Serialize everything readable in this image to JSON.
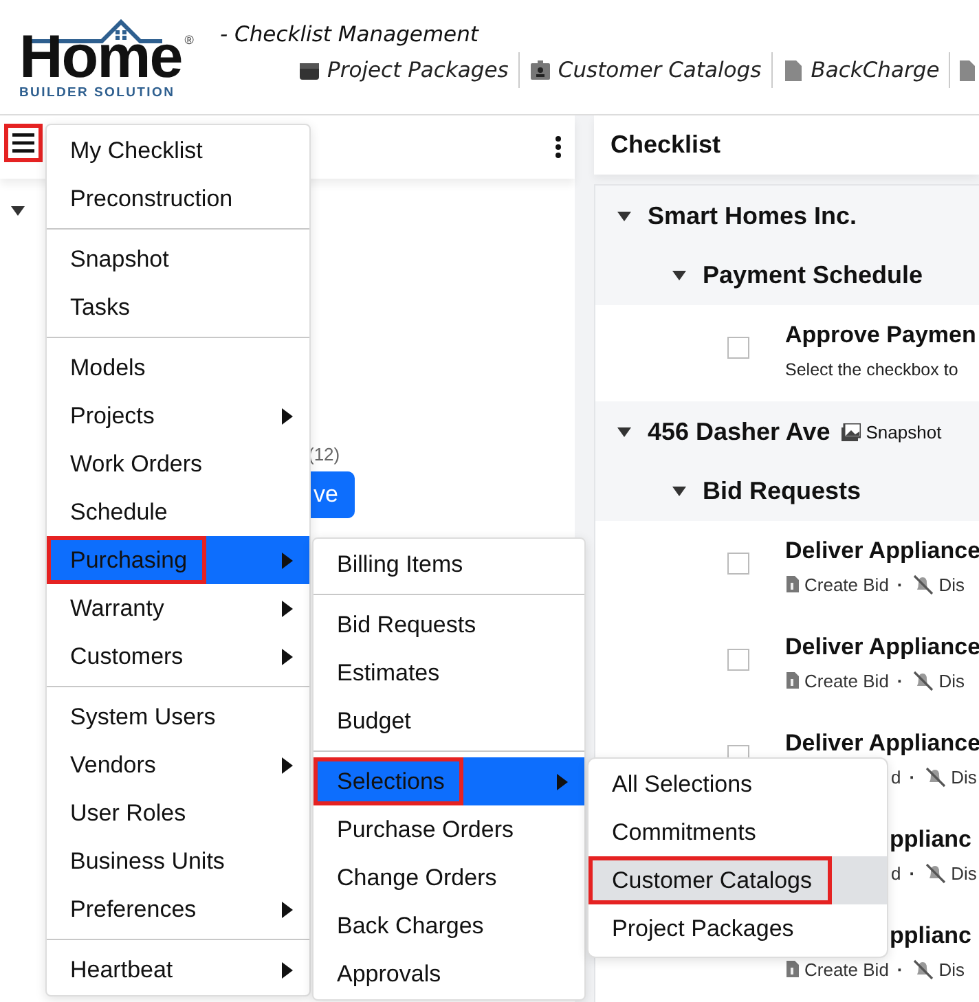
{
  "header": {
    "logo": {
      "word": "Home",
      "mark": "®",
      "tagline": "BUILDER SOLUTION"
    },
    "title": "- Checklist Management",
    "nav": [
      {
        "kind": "package",
        "label": "Project Packages"
      },
      {
        "kind": "badge",
        "label": "Customer Catalogs"
      },
      {
        "kind": "file",
        "label": "BackCharge"
      }
    ]
  },
  "left_panel": {
    "count": "(12)",
    "button": "ve"
  },
  "checklist": {
    "title": "Checklist",
    "groups": [
      {
        "title": "Smart Homes Inc.",
        "sections": [
          {
            "title": "Payment Schedule",
            "items": [
              {
                "kind": "note",
                "title": "Approve Paymen",
                "note": "Select the checkbox to",
                "checked": false
              }
            ]
          }
        ]
      },
      {
        "title": "456 Dasher Ave",
        "tag": "Snapshot",
        "sections": [
          {
            "title": "Bid Requests",
            "items": [
              {
                "kind": "open",
                "title": "Deliver Appliance",
                "action": "Create Bid",
                "separator": "·",
                "dismiss": "Dis",
                "checked": false
              },
              {
                "kind": "open",
                "title": "Deliver Appliance",
                "action": "Create Bid",
                "separator": "·",
                "dismiss": "Dis",
                "checked": false
              },
              {
                "kind": "action-covered",
                "title": "Deliver Appliance",
                "action": "d",
                "separator": "·",
                "dismiss": "Dis",
                "checked": false
              },
              {
                "kind": "covered",
                "title": "pplianc",
                "action": "d",
                "separator": "·",
                "dismiss": "Dis"
              },
              {
                "kind": "title-covered",
                "title": "pplianc",
                "action": "Create Bid",
                "separator": "·",
                "dismiss": "Dis"
              }
            ]
          }
        ]
      }
    ]
  },
  "menu_button": {
    "highlighted": true
  },
  "menus": [
    {
      "sections": [
        [
          {
            "label": "My Checklist",
            "submenu": false,
            "selected": false,
            "highlighted": false
          },
          {
            "label": "Preconstruction",
            "submenu": false,
            "selected": false,
            "highlighted": false
          }
        ],
        [
          {
            "label": "Snapshot",
            "submenu": false,
            "selected": false,
            "highlighted": false
          },
          {
            "label": "Tasks",
            "submenu": false,
            "selected": false,
            "highlighted": false
          }
        ],
        [
          {
            "label": "Models",
            "submenu": false,
            "selected": false,
            "highlighted": false
          },
          {
            "label": "Projects",
            "submenu": true,
            "selected": false,
            "highlighted": false
          },
          {
            "label": "Work Orders",
            "submenu": false,
            "selected": false,
            "highlighted": false
          },
          {
            "label": "Schedule",
            "submenu": false,
            "selected": false,
            "highlighted": false
          },
          {
            "label": "Purchasing",
            "submenu": true,
            "selected": true,
            "highlighted": true
          },
          {
            "label": "Warranty",
            "submenu": true,
            "selected": false,
            "highlighted": false
          },
          {
            "label": "Customers",
            "submenu": true,
            "selected": false,
            "highlighted": false
          }
        ],
        [
          {
            "label": "System Users",
            "submenu": false,
            "selected": false,
            "highlighted": false
          },
          {
            "label": "Vendors",
            "submenu": true,
            "selected": false,
            "highlighted": false
          },
          {
            "label": "User Roles",
            "submenu": false,
            "selected": false,
            "highlighted": false
          },
          {
            "label": "Business Units",
            "submenu": false,
            "selected": false,
            "highlighted": false
          },
          {
            "label": "Preferences",
            "submenu": true,
            "selected": false,
            "highlighted": false
          }
        ],
        [
          {
            "label": "Heartbeat",
            "submenu": true,
            "selected": false,
            "highlighted": false
          }
        ]
      ]
    },
    {
      "sections": [
        [
          {
            "label": "Billing Items",
            "submenu": false,
            "selected": false,
            "highlighted": false
          }
        ],
        [
          {
            "label": "Bid Requests",
            "submenu": false,
            "selected": false,
            "highlighted": false
          },
          {
            "label": "Estimates",
            "submenu": false,
            "selected": false,
            "highlighted": false
          },
          {
            "label": "Budget",
            "submenu": false,
            "selected": false,
            "highlighted": false
          }
        ],
        [
          {
            "label": "Selections",
            "submenu": true,
            "selected": true,
            "highlighted": true
          },
          {
            "label": "Purchase Orders",
            "submenu": false,
            "selected": false,
            "highlighted": false
          },
          {
            "label": "Change Orders",
            "submenu": false,
            "selected": false,
            "highlighted": false
          },
          {
            "label": "Back Charges",
            "submenu": false,
            "selected": false,
            "highlighted": false
          },
          {
            "label": "Approvals",
            "submenu": false,
            "selected": false,
            "highlighted": false
          }
        ]
      ]
    },
    {
      "sections": [
        [
          {
            "label": "All Selections",
            "submenu": false,
            "selected": false,
            "hovered": false,
            "highlighted": false
          },
          {
            "label": "Commitments",
            "submenu": false,
            "selected": false,
            "hovered": false,
            "highlighted": false
          },
          {
            "label": "Customer Catalogs",
            "submenu": false,
            "selected": false,
            "hovered": true,
            "highlighted": true
          },
          {
            "label": "Project Packages",
            "submenu": false,
            "selected": false,
            "hovered": false,
            "highlighted": false
          }
        ]
      ]
    }
  ]
}
